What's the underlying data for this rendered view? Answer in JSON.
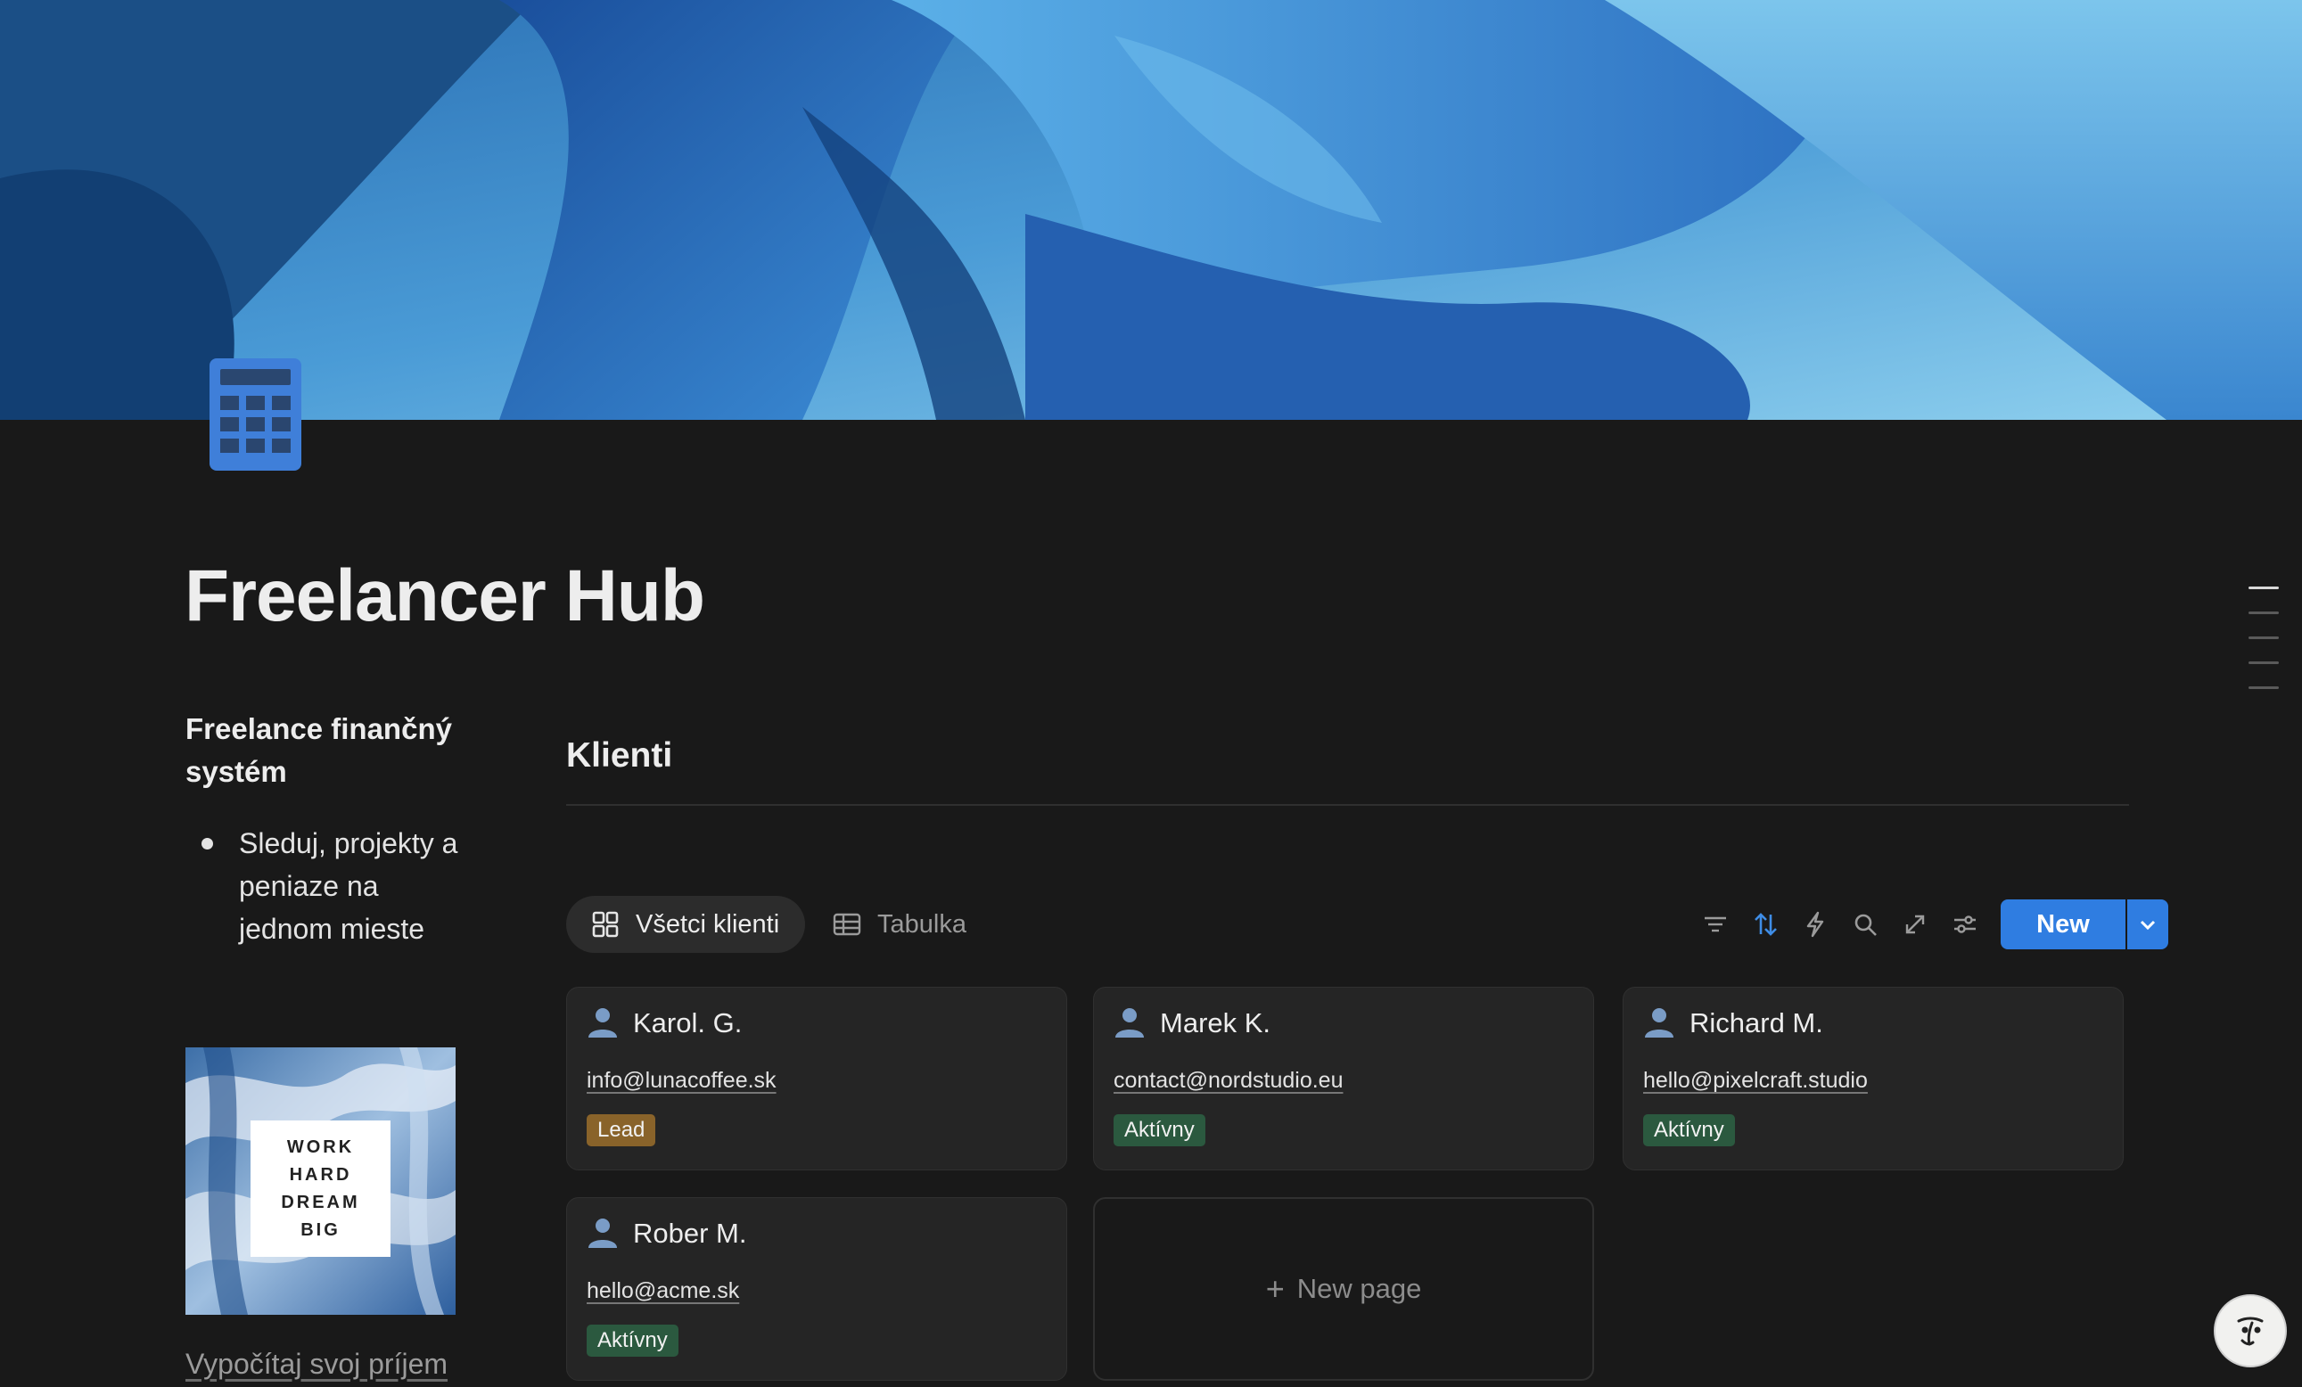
{
  "page": {
    "title": "Freelancer Hub",
    "icon": "calculator-icon"
  },
  "sidebar": {
    "heading": "Freelance finančný systém",
    "bullet": "Sleduj, projekty a peniaze na jednom mieste",
    "image_text": [
      "WORK",
      "HARD",
      "DREAM",
      "BIG"
    ],
    "link": "Vypočítaj svoj príjem"
  },
  "database": {
    "title": "Klienti",
    "views": [
      {
        "label": "Všetci klienti",
        "icon": "gallery-icon",
        "active": true
      },
      {
        "label": "Tabulka",
        "icon": "table-icon",
        "active": false
      }
    ],
    "toolbar": {
      "icons": [
        "filter-icon",
        "sort-icon",
        "automation-icon",
        "search-icon",
        "expand-icon",
        "settings-icon"
      ],
      "new_label": "New"
    },
    "cards": [
      {
        "name": "Karol. G.",
        "email": "info@lunacoffee.sk",
        "status": "Lead"
      },
      {
        "name": "Marek K.",
        "email": "contact@nordstudio.eu",
        "status": "Aktívny"
      },
      {
        "name": "Richard M.",
        "email": "hello@pixelcraft.studio",
        "status": "Aktívny"
      },
      {
        "name": "Rober M.",
        "email": "hello@acme.sk",
        "status": "Aktívny"
      }
    ],
    "new_page_label": "New page"
  },
  "colors": {
    "background": "#191919",
    "accent": "#2f7de1",
    "badge_lead": "#89632a",
    "badge_active": "#2b593f"
  }
}
